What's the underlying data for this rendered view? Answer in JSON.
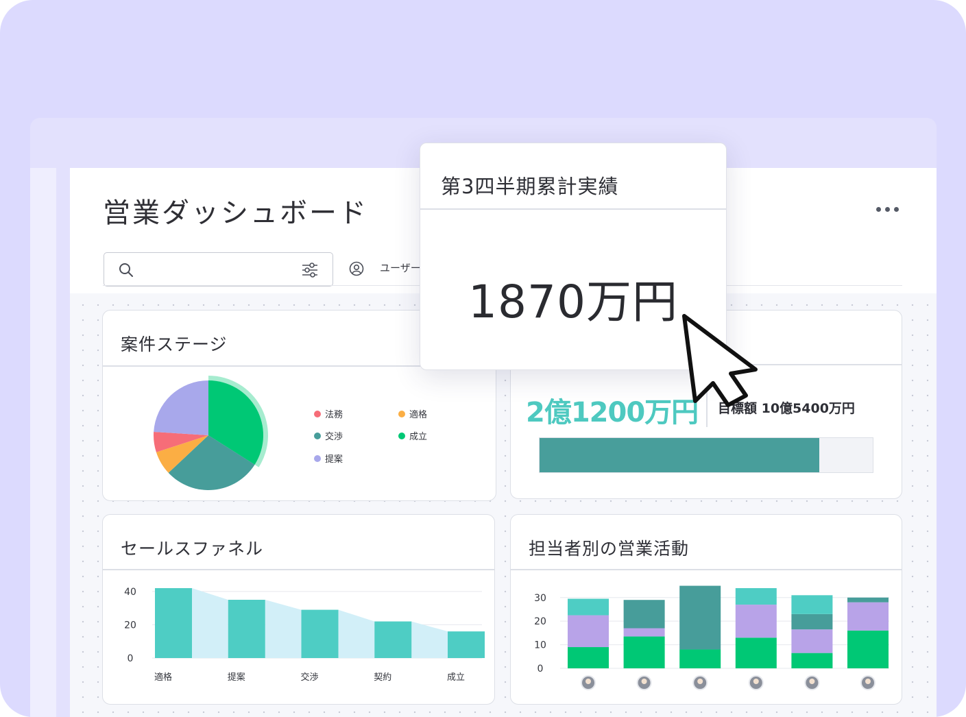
{
  "app": {
    "title": "営業ダッシュボード"
  },
  "toolbar": {
    "user_filter_label": "ユーザー"
  },
  "popup": {
    "title": "第3四半期累計実績",
    "value": "1870万円"
  },
  "deal_stage": {
    "title": "案件ステージ",
    "legend": [
      {
        "label": "法務",
        "color": "#f66d78"
      },
      {
        "label": "適格",
        "color": "#fbae44"
      },
      {
        "label": "交渉",
        "color": "#479d9a"
      },
      {
        "label": "成立",
        "color": "#00c875"
      },
      {
        "label": "提案",
        "color": "#a8a8eb"
      }
    ]
  },
  "revenue": {
    "value": "2億1200万円",
    "target": "目標額 10億5400万円",
    "progress": 0.84
  },
  "funnel": {
    "title": "セールスファネル"
  },
  "activity": {
    "title": "担当者別の営業活動"
  },
  "colors": {
    "accent": "#4ec9c0",
    "teal_dark": "#479d9a",
    "green": "#00c875",
    "purple": "#b8a3e8",
    "background": "#dcdafe"
  },
  "icons": [
    "search-icon",
    "filter-icon",
    "user-icon",
    "more-icon",
    "cursor-icon"
  ],
  "chart_data": [
    {
      "type": "pie",
      "categories": [
        "成立",
        "交渉",
        "適格",
        "法務",
        "提案"
      ],
      "values": [
        34,
        29,
        7,
        6,
        24
      ],
      "colors": [
        "#00c875",
        "#479d9a",
        "#fbae44",
        "#f66d78",
        "#a8a8eb"
      ],
      "highlighted": "成立"
    },
    {
      "type": "bar",
      "categories": [
        "適格",
        "提案",
        "交渉",
        "契約",
        "成立"
      ],
      "values": [
        42,
        35,
        29,
        22,
        16
      ],
      "ylim": [
        0,
        42
      ],
      "yticks": [
        0,
        20,
        40
      ],
      "grid": true
    },
    {
      "type": "bar",
      "stacked": true,
      "categories": [
        "担当者1",
        "担当者2",
        "担当者3",
        "担当者4",
        "担当者5",
        "担当者6"
      ],
      "series": [
        {
          "values": [
            9,
            13.5,
            8,
            13,
            6.5,
            16
          ],
          "color": "#00c875"
        },
        {
          "values": [
            13.5,
            3.5,
            0,
            14,
            10,
            12
          ],
          "color": "#b8a3e8"
        },
        {
          "values": [
            0,
            12,
            27,
            0,
            6.5,
            2
          ],
          "color": "#479d9a"
        },
        {
          "values": [
            7,
            0,
            0,
            7,
            8,
            0
          ],
          "color": "#4ecdc4"
        }
      ],
      "ylim": [
        0,
        34
      ],
      "yticks": [
        0,
        10,
        20,
        30
      ],
      "grid": true
    }
  ]
}
